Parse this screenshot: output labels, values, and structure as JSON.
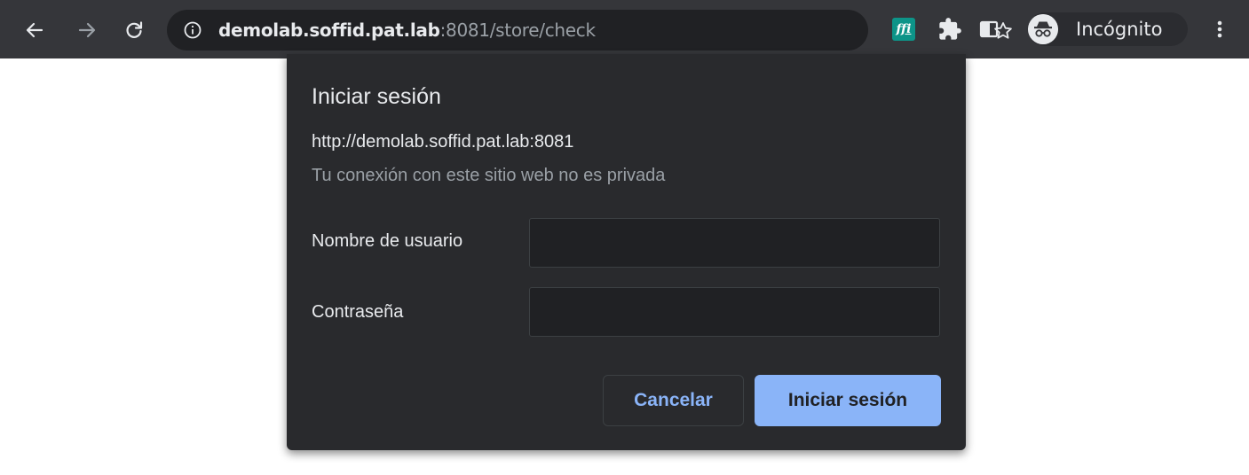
{
  "browser": {
    "url_host": "demolab.soffid.pat.lab",
    "url_rest": ":8081/store/check",
    "incognito_label": "Incógnito",
    "extension_label": "ffi"
  },
  "dialog": {
    "title": "Iniciar sesión",
    "origin": "http://demolab.soffid.pat.lab:8081",
    "warning": "Tu conexión con este sitio web no es privada",
    "username_label": "Nombre de usuario",
    "username_value": "",
    "password_label": "Contraseña",
    "password_value": "",
    "cancel_label": "Cancelar",
    "submit_label": "Iniciar sesión"
  },
  "colors": {
    "toolbar_bg": "#35363a",
    "omnibox_bg": "#202124",
    "dialog_bg": "#292a2d",
    "accent": "#8ab4f8"
  }
}
